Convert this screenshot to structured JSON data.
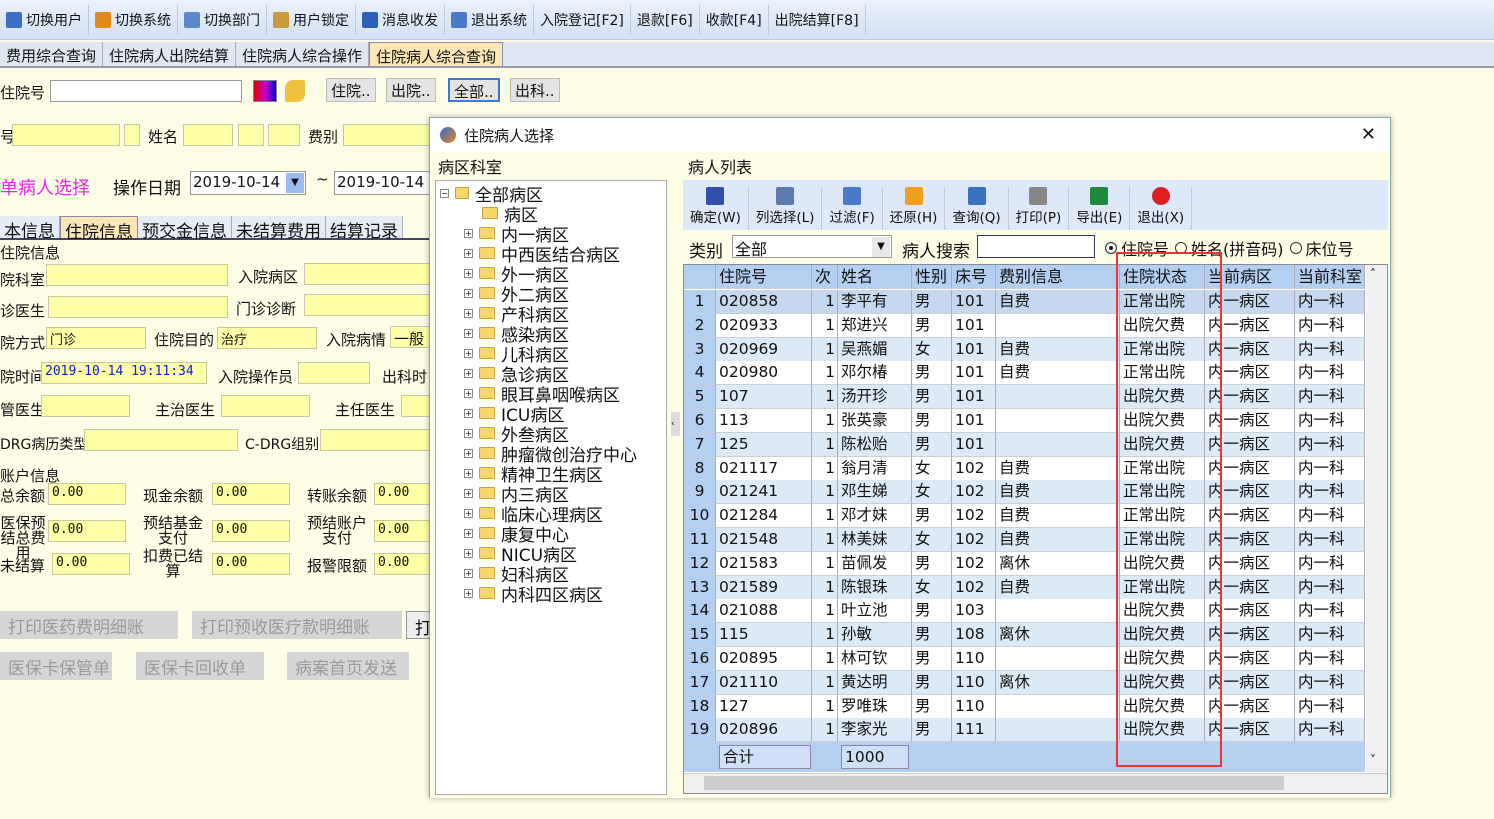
{
  "toolbar": [
    {
      "label": "切换用户",
      "icon": "user-switch-icon",
      "color": "#3a6fc4"
    },
    {
      "label": "切换系统",
      "icon": "system-switch-icon",
      "color": "#e38a1c"
    },
    {
      "label": "切换部门",
      "icon": "department-icon",
      "color": "#5a88c8"
    },
    {
      "label": "用户锁定",
      "icon": "user-lock-icon",
      "color": "#c89a3c"
    },
    {
      "label": "消息收发",
      "icon": "info-icon",
      "color": "#2a5fb8"
    },
    {
      "label": "退出系统",
      "icon": "exit-door-icon",
      "color": "#4a7ac8"
    },
    {
      "label": "入院登记[F2]"
    },
    {
      "label": "退款[F6]"
    },
    {
      "label": "收款[F4]"
    },
    {
      "label": "出院结算[F8]"
    }
  ],
  "tabs": [
    "费用综合查询",
    "住院病人出院结算",
    "住院病人综合操作",
    "住院病人综合查询"
  ],
  "search": {
    "label": "住院号",
    "value": "",
    "btn_in": "住院..",
    "btn_out": "出院..",
    "btn_all": "全部..",
    "btn_dept_out": "出科.."
  },
  "row2": {
    "no_label": "号",
    "name_label": "姓名",
    "fee_label": "费别"
  },
  "row3": {
    "single_select": "单病人选择",
    "date_label": "操作日期",
    "date_from": "2019-10-14",
    "tilde": "~",
    "date_to": "2019-10-14"
  },
  "subtabs": [
    "本信息",
    "住院信息",
    "预交金信息",
    "未结算费用",
    "结算记录"
  ],
  "inpatient": {
    "group": "住院信息",
    "dept": "院科室",
    "ward": "入院病区",
    "doctor": "诊医生",
    "diag": "门诊诊断",
    "mode_label": "院方式",
    "mode": "门诊",
    "purpose_label": "住院目的",
    "purpose": "治疗",
    "cond_label": "入院病情",
    "cond": "一般",
    "time_label": "院时间",
    "time": "2019-10-14 19:11:34",
    "operator": "入院操作员",
    "deptout": "出科时",
    "doc1": "管医生",
    "doc2": "主治医生",
    "doc3": "主任医生",
    "drg_type": "DRG病历类型",
    "drg_group": "C-DRG组别"
  },
  "account": {
    "group": "账户信息",
    "items": [
      {
        "label": "总余额",
        "value": "0.00"
      },
      {
        "label": "现金余额",
        "value": "0.00"
      },
      {
        "label": "转账余额",
        "value": "0.00"
      },
      {
        "label": "医保预结总费用",
        "value": "0.00"
      },
      {
        "label": "预结基金支付",
        "value": "0.00"
      },
      {
        "label": "预结账户支付",
        "value": "0.00"
      },
      {
        "label": "未结算",
        "value": "0.00"
      },
      {
        "label": "扣费已结算",
        "value": "0.00"
      },
      {
        "label": "报警限额",
        "value": "0.00"
      }
    ]
  },
  "bottom_buttons": [
    "打印医药费明细账",
    "打印预收医疗款明细账",
    "打",
    "医保卡保管单",
    "医保卡回收单",
    "病案首页发送"
  ],
  "dialog": {
    "title": "住院病人选择",
    "close": "✕",
    "ward_group": "病区科室",
    "list_group": "病人列表",
    "tree_root": "全部病区",
    "tree": [
      "病区",
      "内一病区",
      "中西医结合病区",
      "外一病区",
      "外二病区",
      "产科病区",
      "感染病区",
      "儿科病区",
      "急诊病区",
      "眼耳鼻咽喉病区",
      "ICU病区",
      "外叁病区",
      "肿瘤微创治疗中心",
      "精神卫生病区",
      "内三病区",
      "临床心理病区",
      "康复中心",
      "NICU病区",
      "妇科病区",
      "内科四区病区"
    ],
    "toolbar": [
      {
        "label": "确定(W)",
        "icon": "checkbox-icon",
        "color": "#3050b0"
      },
      {
        "label": "列选择(L)",
        "icon": "columns-icon",
        "color": "#5a7ab0"
      },
      {
        "label": "过滤(F)",
        "icon": "filter-icon",
        "color": "#4a7ac8"
      },
      {
        "label": "还原(H)",
        "icon": "undo-arrow-icon",
        "color": "#f0a020"
      },
      {
        "label": "查询(Q)",
        "icon": "refresh-icon",
        "color": "#3a70c0"
      },
      {
        "label": "打印(P)",
        "icon": "printer-icon",
        "color": "#888888"
      },
      {
        "label": "导出(E)",
        "icon": "excel-icon",
        "color": "#1f8a3a"
      },
      {
        "label": "退出(X)",
        "icon": "power-icon",
        "color": "#e02020"
      }
    ],
    "category_label": "类别",
    "category": "全部",
    "search_label": "病人搜索",
    "search_value": "",
    "radios": [
      {
        "label": "住院号",
        "checked": true
      },
      {
        "label": "姓名(拼音码)",
        "checked": false
      },
      {
        "label": "床位号",
        "checked": false
      }
    ],
    "columns": [
      "住院号",
      "次",
      "姓名",
      "性别",
      "床号",
      "费别信息",
      "住院状态",
      "当前病区",
      "当前科室"
    ],
    "rows": [
      [
        "1",
        "020858",
        "1",
        "李平有",
        "男",
        "101",
        "自费",
        "正常出院",
        "内一病区",
        "内一科"
      ],
      [
        "2",
        "020933",
        "1",
        "郑进兴",
        "男",
        "101",
        "",
        "出院欠费",
        "内一病区",
        "内一科"
      ],
      [
        "3",
        "020969",
        "1",
        "吴燕媚",
        "女",
        "101",
        "自费",
        "正常出院",
        "内一病区",
        "内一科"
      ],
      [
        "4",
        "020980",
        "1",
        "邓尔椿",
        "男",
        "101",
        "自费",
        "正常出院",
        "内一病区",
        "内一科"
      ],
      [
        "5",
        "107",
        "1",
        "汤开珍",
        "男",
        "101",
        "",
        "出院欠费",
        "内一病区",
        "内一科"
      ],
      [
        "6",
        "113",
        "1",
        "张英豪",
        "男",
        "101",
        "",
        "出院欠费",
        "内一病区",
        "内一科"
      ],
      [
        "7",
        "125",
        "1",
        "陈松贻",
        "男",
        "101",
        "",
        "出院欠费",
        "内一病区",
        "内一科"
      ],
      [
        "8",
        "021117",
        "1",
        "翁月清",
        "女",
        "102",
        "自费",
        "正常出院",
        "内一病区",
        "内一科"
      ],
      [
        "9",
        "021241",
        "1",
        "邓生娣",
        "女",
        "102",
        "自费",
        "正常出院",
        "内一病区",
        "内一科"
      ],
      [
        "10",
        "021284",
        "1",
        "邓才妹",
        "男",
        "102",
        "自费",
        "正常出院",
        "内一病区",
        "内一科"
      ],
      [
        "11",
        "021548",
        "1",
        "林美妹",
        "女",
        "102",
        "自费",
        "正常出院",
        "内一病区",
        "内一科"
      ],
      [
        "12",
        "021583",
        "1",
        "苗佩发",
        "男",
        "102",
        "离休",
        "出院欠费",
        "内一病区",
        "内一科"
      ],
      [
        "13",
        "021589",
        "1",
        "陈银珠",
        "女",
        "102",
        "自费",
        "正常出院",
        "内一病区",
        "内一科"
      ],
      [
        "14",
        "021088",
        "1",
        "叶立池",
        "男",
        "103",
        "",
        "出院欠费",
        "内一病区",
        "内一科"
      ],
      [
        "15",
        "115",
        "1",
        "孙敏",
        "男",
        "108",
        "离休",
        "出院欠费",
        "内一病区",
        "内一科"
      ],
      [
        "16",
        "020895",
        "1",
        "林可钦",
        "男",
        "110",
        "",
        "出院欠费",
        "内一病区",
        "内一科"
      ],
      [
        "17",
        "021110",
        "1",
        "黄达明",
        "男",
        "110",
        "离休",
        "出院欠费",
        "内一病区",
        "内一科"
      ],
      [
        "18",
        "127",
        "1",
        "罗唯珠",
        "男",
        "110",
        "",
        "出院欠费",
        "内一病区",
        "内一科"
      ],
      [
        "19",
        "020896",
        "1",
        "李家光",
        "男",
        "111",
        "",
        "出院欠费",
        "内一病区",
        "内一科"
      ]
    ],
    "total_label": "合计",
    "total_value": "1000",
    "highlight_color": "#ee3333"
  }
}
